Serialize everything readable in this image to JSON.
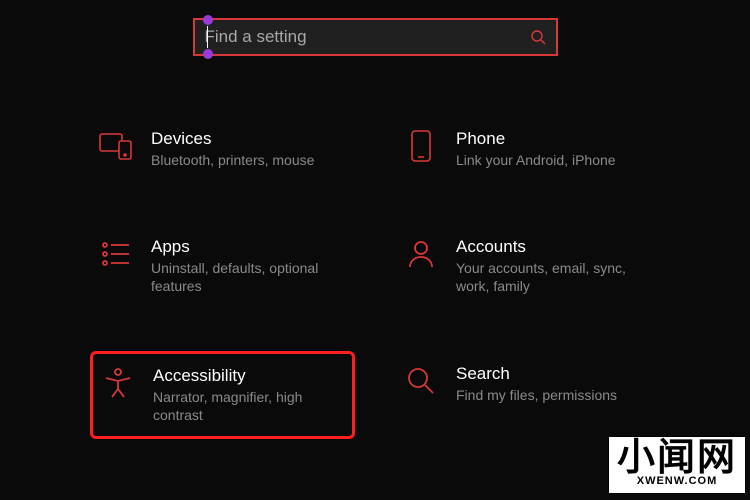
{
  "search": {
    "placeholder": "Find a setting"
  },
  "tiles": {
    "devices": {
      "title": "Devices",
      "sub": "Bluetooth, printers, mouse"
    },
    "phone": {
      "title": "Phone",
      "sub": "Link your Android, iPhone"
    },
    "apps": {
      "title": "Apps",
      "sub": "Uninstall, defaults, optional features"
    },
    "accounts": {
      "title": "Accounts",
      "sub": "Your accounts, email, sync, work, family"
    },
    "accessibility": {
      "title": "Accessibility",
      "sub": "Narrator, magnifier, high contrast"
    },
    "search": {
      "title": "Search",
      "sub": "Find my files, permissions"
    }
  },
  "watermark": {
    "main": "小闻网",
    "sub": "XWENW.COM"
  },
  "colors": {
    "accent": "#d83838",
    "highlight": "#ff1f1f",
    "background": "#0a0a0a"
  }
}
